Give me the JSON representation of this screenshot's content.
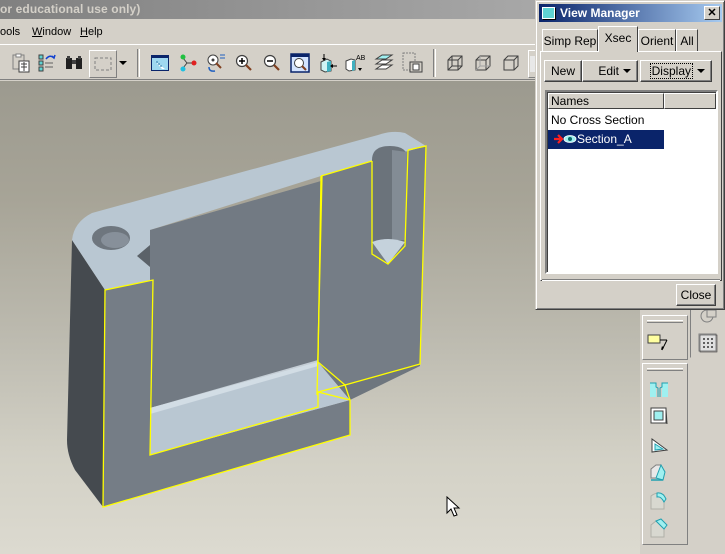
{
  "window": {
    "title": "or educational use only)"
  },
  "menu": {
    "items": [
      {
        "label": "ools",
        "mnemonic": ""
      },
      {
        "label": "Window",
        "mnemonic": "W"
      },
      {
        "label": "Help",
        "mnemonic": "H"
      }
    ]
  },
  "toolbar": {
    "icons": [
      "paste-special-icon",
      "regenerate-icon",
      "find-icon",
      "select-box-icon",
      "dropdown-arrow-icon",
      "repaint-icon",
      "spin-center-icon",
      "orient-mode-icon",
      "zoom-in-icon",
      "zoom-out-icon",
      "refit-icon",
      "reorient-icon",
      "saved-views-icon",
      "layers-icon",
      "model-display-icon",
      "wireframe-icon",
      "hidden-line-icon",
      "no-hidden-icon",
      "shading-icon"
    ]
  },
  "view_manager": {
    "title": "View Manager",
    "close_glyph": "✕",
    "tabs": [
      {
        "label": "Simp Rep",
        "active": false
      },
      {
        "label": "Xsec",
        "active": true
      },
      {
        "label": "Orient",
        "active": false
      },
      {
        "label": "All",
        "active": false
      }
    ],
    "buttons": {
      "new": "New",
      "edit": "Edit",
      "display": "Display"
    },
    "list": {
      "column_header": "Names",
      "rows": [
        {
          "label": "No Cross Section",
          "selected": false,
          "active_marker": false
        },
        {
          "label": "Section_A",
          "selected": true,
          "active_marker": true
        }
      ]
    },
    "close_button": "Close"
  },
  "right_toolbar": {
    "icons": [
      "analysis-icon",
      "table-icon",
      "note-icon",
      "hole-icon",
      "shell-icon",
      "rib-icon",
      "draft-icon",
      "round-icon",
      "chamfer-icon"
    ]
  },
  "model": {
    "name": "cross-section part",
    "section_edge_color": "#ffff00",
    "surface_color": "#b9c7d2",
    "face_dark": "#454a4f",
    "face_mid": "#707880"
  },
  "colors": {
    "dialog_title_start": "#0a246a",
    "dialog_title_end": "#a6caf0",
    "selection": "#0a246a",
    "chrome": "#d4d0c8"
  }
}
